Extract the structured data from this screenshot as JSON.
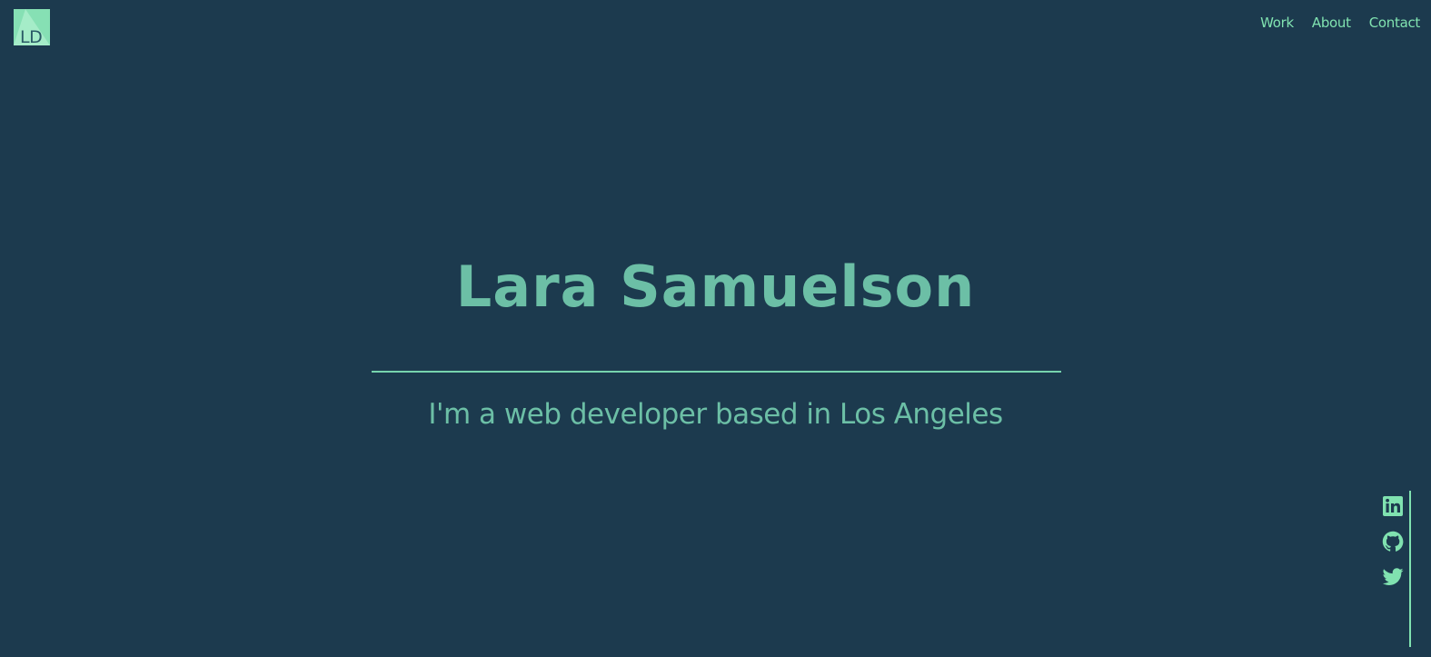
{
  "logo": {
    "text": "LD"
  },
  "nav": {
    "items": [
      {
        "label": "Work"
      },
      {
        "label": "About"
      },
      {
        "label": "Contact"
      }
    ]
  },
  "hero": {
    "title": "Lara Samuelson",
    "subtitle": "I'm a web developer based in Los Angeles"
  },
  "social": {
    "icons": [
      "linkedin-icon",
      "github-icon",
      "twitter-icon"
    ]
  },
  "colors": {
    "background": "#1c3a4e",
    "accent": "#80e2b0",
    "text": "#6cbfa6"
  }
}
